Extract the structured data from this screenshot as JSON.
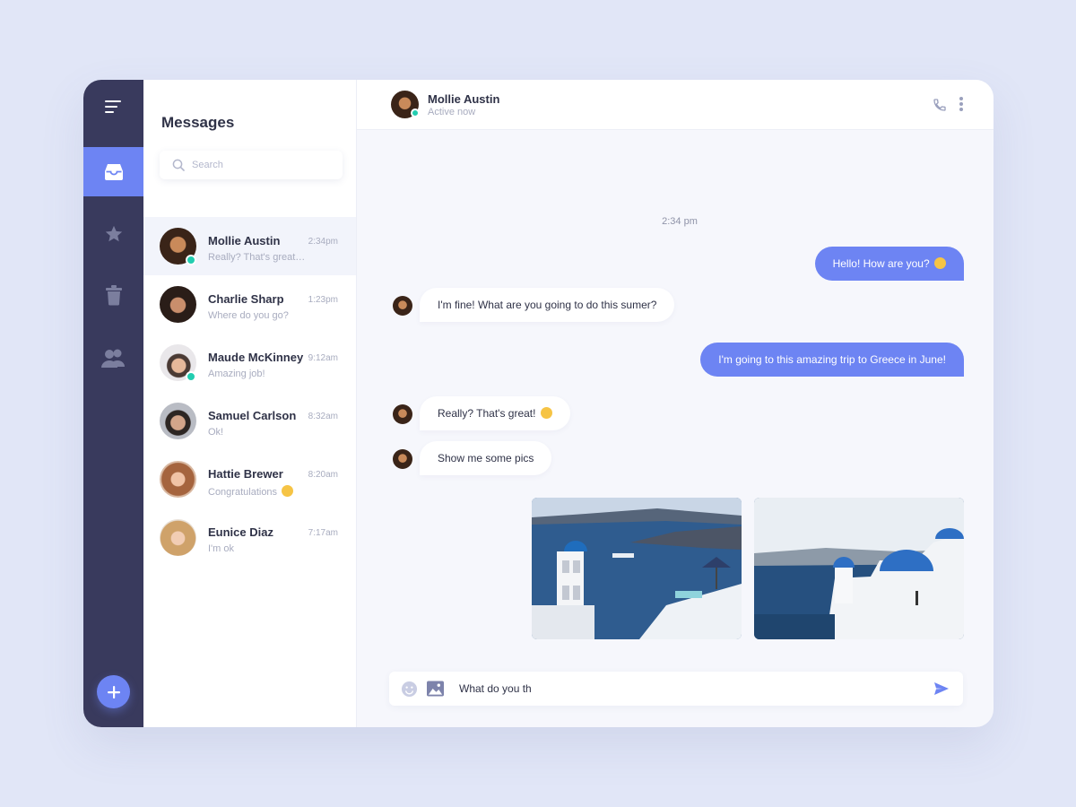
{
  "colors": {
    "accent": "#6d84f3",
    "sidebar": "#393a5d",
    "online": "#22cdb0",
    "background": "#e1e6f7"
  },
  "sidebar": {
    "items": [
      {
        "icon": "inbox-icon",
        "active": true
      },
      {
        "icon": "star-icon",
        "active": false
      },
      {
        "icon": "trash-icon",
        "active": false
      },
      {
        "icon": "contacts-icon",
        "active": false
      }
    ],
    "add_icon": "plus-icon"
  },
  "messages_panel": {
    "title": "Messages",
    "search_placeholder": "Search",
    "contacts": [
      {
        "name": "Mollie Austin",
        "preview": "Really? That's great…",
        "time": "2:34pm",
        "online": true,
        "active": true
      },
      {
        "name": "Charlie Sharp",
        "preview": "Where do you go?",
        "time": "1:23pm",
        "online": false,
        "active": false
      },
      {
        "name": "Maude McKinney",
        "preview": "Amazing job!",
        "time": "9:12am",
        "online": true,
        "active": false
      },
      {
        "name": "Samuel Carlson",
        "preview": "Ok!",
        "time": "8:32am",
        "online": false,
        "active": false
      },
      {
        "name": "Hattie Brewer",
        "preview": "Congratulations",
        "time": "8:20am",
        "online": false,
        "active": false
      },
      {
        "name": "Eunice Diaz",
        "preview": "I'm ok",
        "time": "7:17am",
        "online": false,
        "active": false
      }
    ]
  },
  "chat": {
    "header": {
      "name": "Mollie Austin",
      "status": "Active now"
    },
    "time_separator": "2:34 pm",
    "messages": [
      {
        "direction": "out",
        "text": "Hello! How are you?",
        "emoji": "smile"
      },
      {
        "direction": "in",
        "text": "I'm fine! What are you going to do this sumer?"
      },
      {
        "direction": "out",
        "text": "I'm going to this amazing trip to Greece in June!"
      },
      {
        "direction": "in",
        "text": "Really? That's great!",
        "emoji": "smirk"
      },
      {
        "direction": "in",
        "text": "Show me some pics"
      }
    ],
    "photos": [
      "santorini-bell-tower-photo",
      "santorini-domes-photo"
    ],
    "composer": {
      "value": "What do you th"
    }
  }
}
